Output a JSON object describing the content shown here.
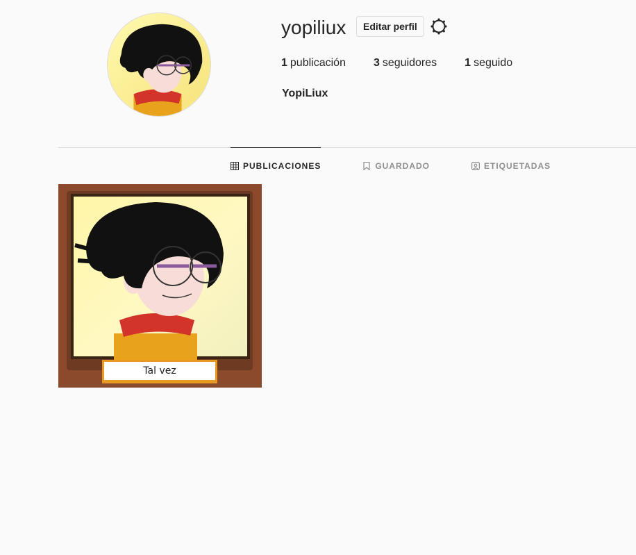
{
  "profile": {
    "username": "yopiliux",
    "edit_label": "Editar perfil",
    "full_name": "YopiLiux",
    "stats": [
      {
        "count": "1",
        "label": "publicación"
      },
      {
        "count": "3",
        "label": "seguidores"
      },
      {
        "count": "1",
        "label": "seguido"
      }
    ]
  },
  "icons": {
    "settings": "gear-icon",
    "posts_tab": "grid-icon",
    "saved_tab": "bookmark-icon",
    "tagged_tab": "tag-person-icon"
  },
  "tabs": [
    {
      "label": "PUBLICACIONES",
      "active": true
    },
    {
      "label": "GUARDADO",
      "active": false
    },
    {
      "label": "ETIQUETADAS",
      "active": false
    }
  ],
  "posts": [
    {
      "caption": "Tal vez"
    }
  ],
  "colors": {
    "background": "#fafafa",
    "text": "#262626",
    "muted": "#8e8e8e",
    "border": "#dbdbdb",
    "frame": "#8b4a2b"
  }
}
